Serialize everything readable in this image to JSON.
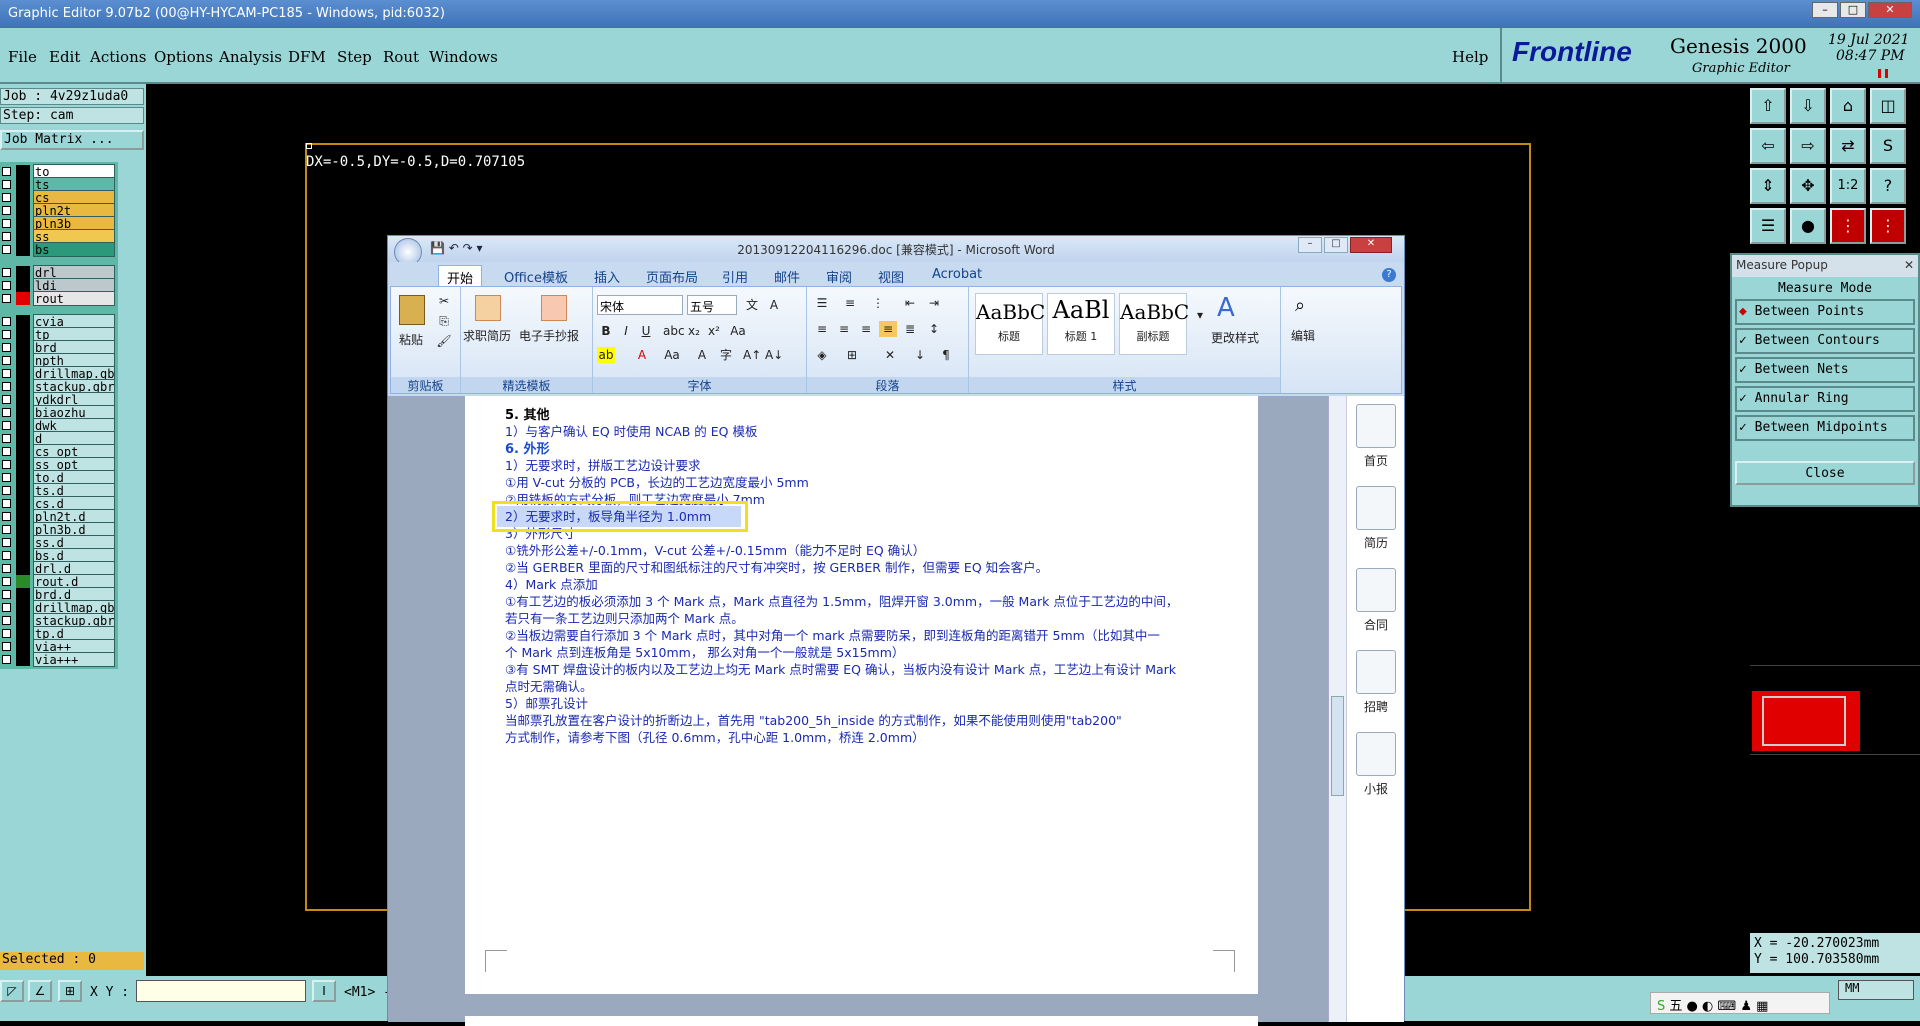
{
  "genesis": {
    "title_bar": "Graphic Editor 9.07b2 (00@HY-HYCAM-PC185 - Windows, pid:6032)",
    "menu": [
      "File",
      "Edit",
      "Actions",
      "Options",
      "Analysis",
      "DFM",
      "Step",
      "Rout",
      "Windows"
    ],
    "help": "Help",
    "brand": "Frontline",
    "product": "Genesis 2000",
    "subtitle": "Graphic Editor",
    "date": "19 Jul 2021",
    "time": "08:47 PM",
    "job": "Job : 4v29z1uda0",
    "step": "Step: cam",
    "job_matrix": "Job Matrix ...",
    "layers": [
      {
        "name": "to",
        "color": "#ffffff",
        "swatch": "#000000"
      },
      {
        "name": "ts",
        "color": "#5fb8a6",
        "swatch": "#000000"
      },
      {
        "name": "cs",
        "color": "#e8b840",
        "swatch": "#000000"
      },
      {
        "name": "pln2t",
        "color": "#e8b840",
        "swatch": "#000000"
      },
      {
        "name": "pln3b",
        "color": "#e8b840",
        "swatch": "#000000"
      },
      {
        "name": "ss",
        "color": "#f0c850",
        "swatch": "#000000"
      },
      {
        "name": "bs",
        "color": "#2a9a7a",
        "swatch": "#000000"
      },
      {
        "name": "drl",
        "color": "#bcc8cc",
        "swatch": "#000000"
      },
      {
        "name": "ldi",
        "color": "#bcc8cc",
        "swatch": "#000000"
      },
      {
        "name": "rout",
        "color": "#e6e6e6",
        "swatch": "#e00000"
      },
      {
        "name": "cvia",
        "color": "#bfe3e3",
        "swatch": "#000000"
      },
      {
        "name": "tp",
        "color": "#bfe3e3",
        "swatch": "#000000"
      },
      {
        "name": "brd",
        "color": "#bfe3e3",
        "swatch": "#000000"
      },
      {
        "name": "npth",
        "color": "#bfe3e3",
        "swatch": "#000000"
      },
      {
        "name": "drillmap.gbr",
        "color": "#bfe3e3",
        "swatch": "#000000"
      },
      {
        "name": "stackup.gbr",
        "color": "#bfe3e3",
        "swatch": "#000000"
      },
      {
        "name": "ydkdrl",
        "color": "#bfe3e3",
        "swatch": "#000000"
      },
      {
        "name": "biaozhu",
        "color": "#bfe3e3",
        "swatch": "#000000"
      },
      {
        "name": "dwk",
        "color": "#bfe3e3",
        "swatch": "#000000"
      },
      {
        "name": "d",
        "color": "#bfe3e3",
        "swatch": "#000000"
      },
      {
        "name": "cs_opt",
        "color": "#bfe3e3",
        "swatch": "#000000"
      },
      {
        "name": "ss_opt",
        "color": "#bfe3e3",
        "swatch": "#000000"
      },
      {
        "name": "to.d",
        "color": "#bfe3e3",
        "swatch": "#000000"
      },
      {
        "name": "ts.d",
        "color": "#bfe3e3",
        "swatch": "#000000"
      },
      {
        "name": "cs.d",
        "color": "#bfe3e3",
        "swatch": "#000000"
      },
      {
        "name": "pln2t.d",
        "color": "#bfe3e3",
        "swatch": "#000000"
      },
      {
        "name": "pln3b.d",
        "color": "#bfe3e3",
        "swatch": "#000000"
      },
      {
        "name": "ss.d",
        "color": "#bfe3e3",
        "swatch": "#000000"
      },
      {
        "name": "bs.d",
        "color": "#bfe3e3",
        "swatch": "#000000"
      },
      {
        "name": "drl.d",
        "color": "#bfe3e3",
        "swatch": "#000000"
      },
      {
        "name": "rout.d",
        "color": "#bfe3e3",
        "swatch": "#2a8a2a"
      },
      {
        "name": "brd.d",
        "color": "#bfe3e3",
        "swatch": "#000000"
      },
      {
        "name": "drillmap.gbr",
        "color": "#bfe3e3",
        "swatch": "#000000"
      },
      {
        "name": "stackup.gbr",
        "color": "#bfe3e3",
        "swatch": "#000000"
      },
      {
        "name": "tp.d",
        "color": "#bfe3e3",
        "swatch": "#000000"
      },
      {
        "name": "via++",
        "color": "#bfe3e3",
        "swatch": "#000000"
      },
      {
        "name": "via+++",
        "color": "#bfe3e3",
        "swatch": "#000000"
      }
    ],
    "measure_readout": "DX=-0.5,DY=-0.5,D=0.707105",
    "selected": "Selected : 0",
    "xy_label": "X Y :",
    "m1_label": "<M1> -",
    "units": "MM",
    "cursor_x": "X = -20.270023mm",
    "cursor_y": "Y = 100.703580mm"
  },
  "measure_popup": {
    "title": "Measure Popup",
    "mode_label": "Measure Mode",
    "options": [
      "Between Points",
      "Between Contours",
      "Between Nets",
      "Annular Ring",
      "Between Midpoints"
    ],
    "close": "Close"
  },
  "word": {
    "title": "20130912204116296.doc [兼容模式] - Microsoft Word",
    "tabs": [
      "开始",
      "Office模板",
      "插入",
      "页面布局",
      "引用",
      "邮件",
      "审阅",
      "视图",
      "Acrobat"
    ],
    "groups": {
      "clipboard": "剪贴板",
      "paste": "粘贴",
      "templates": "精选模板",
      "resume": "求职简历",
      "handwrite": "电子手抄报",
      "font": "字体",
      "font_name": "宋体",
      "font_size": "五号",
      "paragraph": "段落",
      "styles": "样式",
      "change_styles": "更改样式",
      "edit": "编辑"
    },
    "styles": [
      {
        "sample": "AaBbC",
        "label": "标题"
      },
      {
        "sample": "AaBl",
        "label": "标题 1"
      },
      {
        "sample": "AaBbC",
        "label": "副标题"
      }
    ],
    "sidebar": [
      "首页",
      "简历",
      "合同",
      "招聘",
      "小报"
    ],
    "doc_lines": [
      "5. 其他",
      "1）与客户确认 EQ 时使用 NCAB 的 EQ 模板",
      "6. 外形",
      "1）无要求时，拼版工艺边设计要求",
      "①用 V-cut 分板的 PCB，长边的工艺边宽度最小 5mm",
      "②用铣板的方式分板，则工艺边宽度最小 7mm",
      "2）无要求时，板导角半径为 1.0mm",
      "3）外形尺寸",
      "①铣外形公差+/-0.1mm，V-cut 公差+/-0.15mm（能力不足时 EQ 确认）",
      "②当 GERBER 里面的尺寸和图纸标注的尺寸有冲突时，按 GERBER 制作，但需要 EQ 知会客户。",
      "4）Mark 点添加",
      "①有工艺边的板必须添加 3 个 Mark 点，Mark 点直径为 1.5mm，阻焊开窗 3.0mm，一般 Mark 点位于工艺边的中间，",
      "若只有一条工艺边则只添加两个 Mark 点。",
      "②当板边需要自行添加 3 个 Mark 点时，其中对角一个 mark 点需要防呆，即到连板角的距离错开 5mm（比如其中一",
      "个 Mark 点到连板角是 5x10mm， 那么对角一个一般就是 5x15mm）",
      "③有 SMT 焊盘设计的板内以及工艺边上均无 Mark 点时需要 EQ 确认，当板内没有设计 Mark 点，工艺边上有设计 Mark",
      "点时无需确认。",
      "5）邮票孔设计",
      "当邮票孔放置在客户设计的折断边上，首先用 \"tab200_5h_inside 的方式制作，如果不能使用则使用\"tab200\"",
      "方式制作，请参考下图（孔径 0.6mm，孔中心距 1.0mm，桥连 2.0mm）"
    ]
  },
  "taskbar": {
    "ime": "五"
  }
}
